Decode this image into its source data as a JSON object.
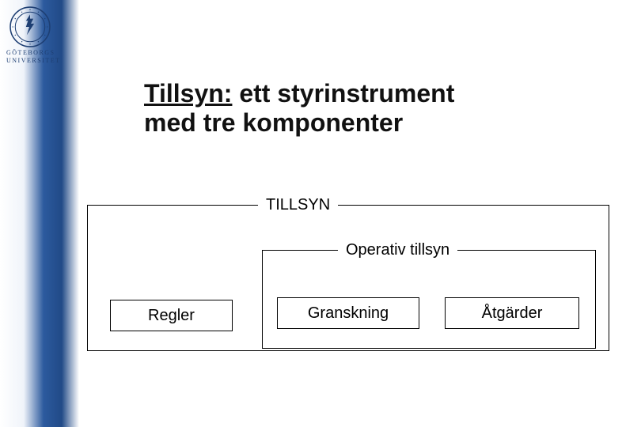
{
  "branding": {
    "institution_line1": "GÖTEBORGS",
    "institution_line2": "UNIVERSITET"
  },
  "title": {
    "underlined": "Tillsyn:",
    "rest_line1": " ett styrinstrument",
    "line2": "med tre komponenter"
  },
  "diagram": {
    "outer_label": "TILLSYN",
    "operativ_label": "Operativ tillsyn",
    "boxes": {
      "regler": "Regler",
      "granskning": "Granskning",
      "atgarder": "Åtgärder"
    }
  }
}
